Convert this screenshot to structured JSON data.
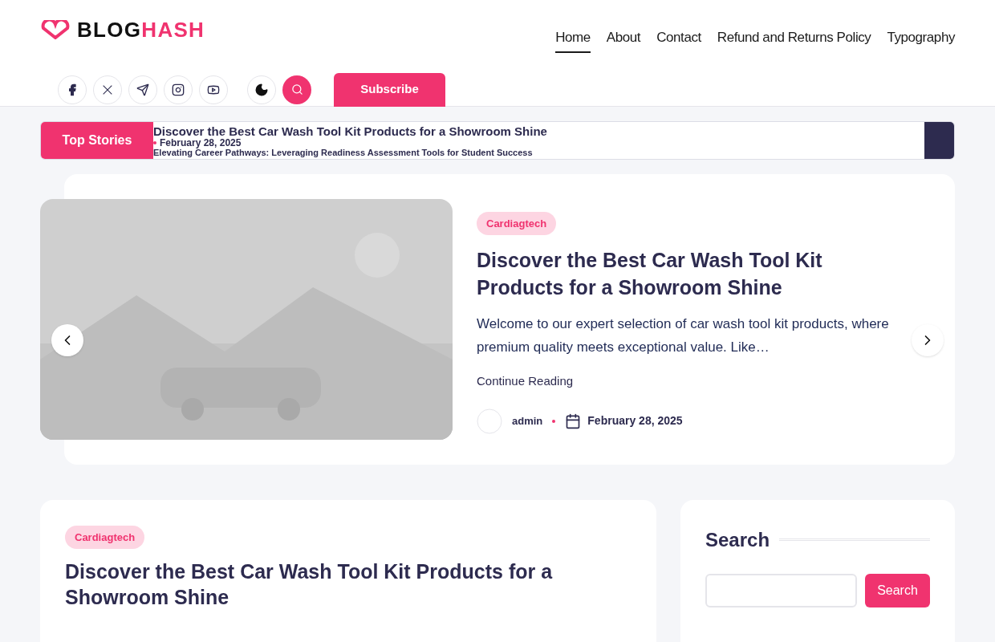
{
  "logo": {
    "part_1": "BLOG",
    "part_2": "HASH"
  },
  "nav": [
    {
      "label": "Home",
      "selected": true
    },
    {
      "label": "About",
      "selected": false
    },
    {
      "label": "Contact",
      "selected": false
    },
    {
      "label": "Refund and Returns Policy",
      "selected": false
    },
    {
      "label": "Typography",
      "selected": false
    }
  ],
  "social": [
    {
      "kind": "facebook"
    },
    {
      "kind": "x"
    },
    {
      "kind": "telegram"
    },
    {
      "kind": "instagram"
    },
    {
      "kind": "youtube"
    }
  ],
  "subscribe": "Subscribe",
  "ticker": {
    "label": "Top Stories",
    "items": [
      {
        "title": "Discover the Best Car Wash Tool Kit Products for a Showroom Shine",
        "date": "February 28, 2025"
      },
      {
        "title": "Elevating Career Pathways: Leveraging Readiness Assessment Tools for Student Success"
      }
    ]
  },
  "hero": {
    "category": "Cardiagtech",
    "title": "Discover the Best Car Wash Tool Kit Products for a Showroom Shine",
    "excerpt": "Welcome to our expert selection of car wash tool kit products, where premium quality meets exceptional value. Like…",
    "more": "Continue Reading",
    "author": "admin",
    "date": "February 28, 2025"
  },
  "post": {
    "category": "Cardiagtech",
    "title": "Discover the Best Car Wash Tool Kit Products for a Showroom Shine"
  },
  "sidebar": {
    "title": "Search",
    "button": "Search"
  }
}
